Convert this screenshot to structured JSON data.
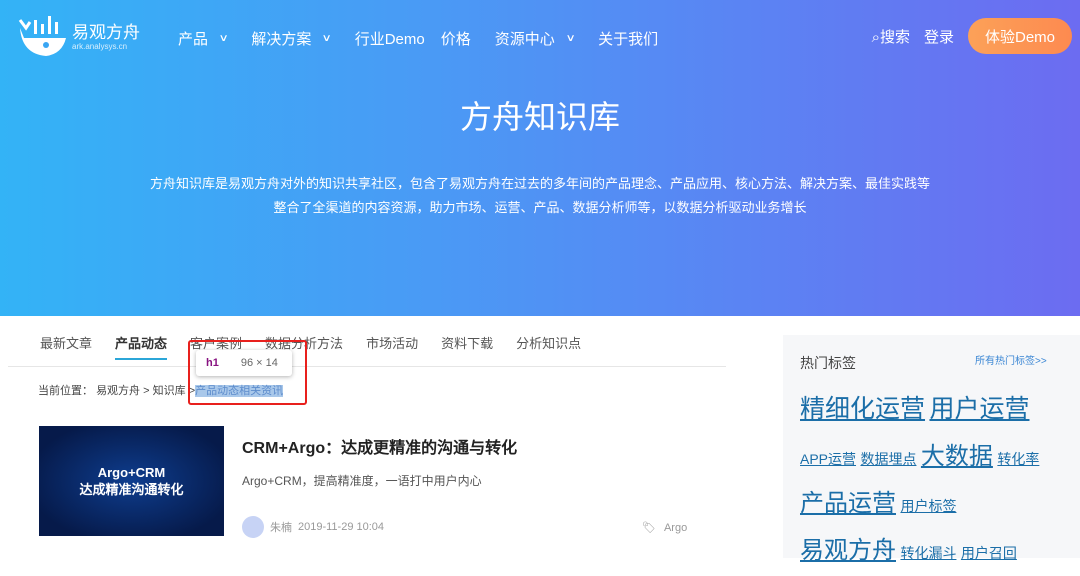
{
  "header": {
    "brand": "易观方舟",
    "domain": "ark.analysys.cn",
    "nav": [
      {
        "label": "产品",
        "dropdown": true
      },
      {
        "label": "解决方案",
        "dropdown": true
      },
      {
        "label": "行业Demo"
      },
      {
        "label": "价格"
      },
      {
        "label": "资源中心",
        "dropdown": true
      },
      {
        "label": "关于我们"
      }
    ],
    "search": "搜索",
    "login": "登录",
    "cta": "体验Demo"
  },
  "hero": {
    "title": "方舟知识库",
    "desc1": "方舟知识库是易观方舟对外的知识共享社区，包含了易观方舟在过去的多年间的产品理念、产品应用、核心方法、解决方案、最佳实践等",
    "desc2": "整合了全渠道的内容资源，助力市场、运营、产品、数据分析师等，以数据分析驱动业务增长"
  },
  "tabs": [
    "最新文章",
    "产品动态",
    "客户案例",
    "数据分析方法",
    "市场活动",
    "资料下载",
    "分析知识点"
  ],
  "breadcrumb": {
    "label": "当前位置：",
    "items": [
      "易观方舟",
      "知识库"
    ],
    "sep": ">",
    "current": "产品动态相关资讯"
  },
  "devtools_tip": {
    "tag": "h1",
    "size": "96 × 14"
  },
  "article": {
    "thumb_line1": "Argo+CRM",
    "thumb_line2": "达成精准沟通转化",
    "title": "CRM+Argo：达成更精准的沟通与转化",
    "summary": "Argo+CRM，提高精准度，一语打中用户内心",
    "author": "朱楠",
    "date": "2019-11-29 10:04",
    "tag": "Argo"
  },
  "sidebar": {
    "title": "热门标签",
    "all": "所有热门标签>>",
    "tags": [
      "精细化运营",
      "用户运营",
      "APP运营",
      "数据埋点",
      "大数据",
      "转化率",
      "产品运营",
      "用户标签",
      "易观方舟",
      "转化漏斗",
      "用户召回"
    ]
  }
}
